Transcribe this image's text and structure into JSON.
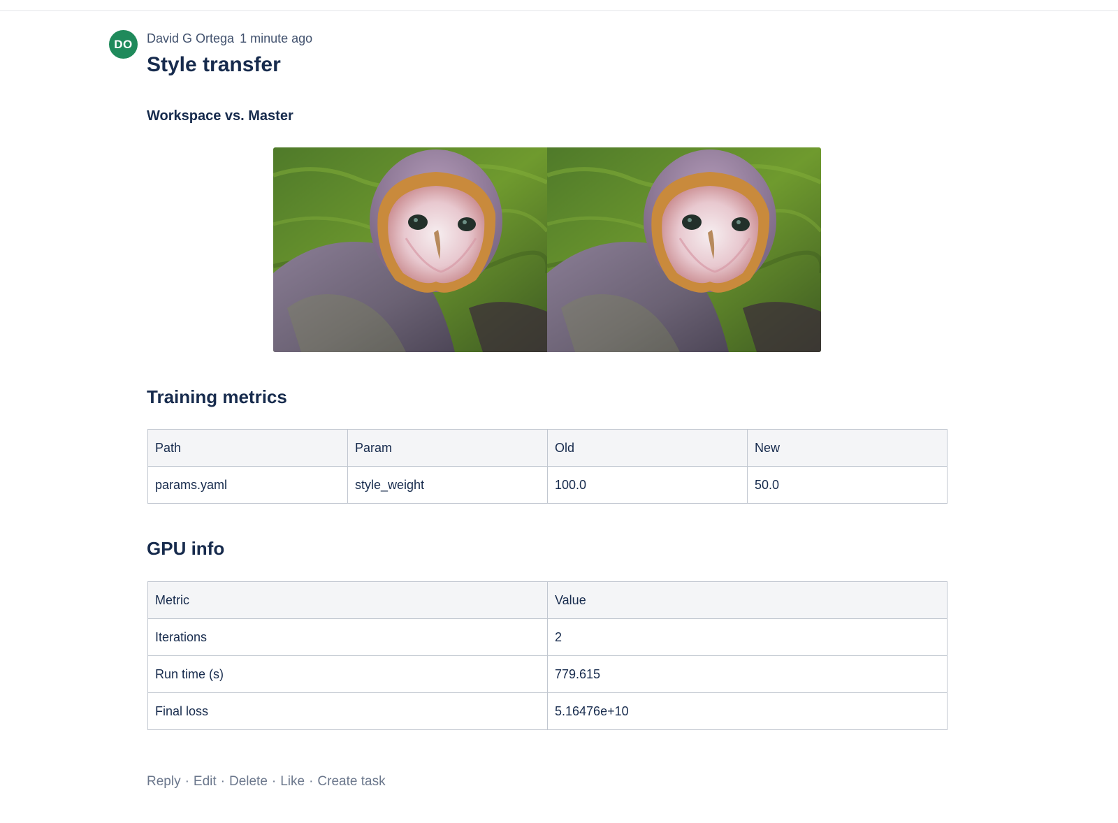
{
  "comment": {
    "author_initials": "DO",
    "author": "David G Ortega",
    "timestamp": "1 minute ago",
    "title": "Style transfer",
    "subheading": "Workspace vs. Master",
    "image_left_label": "Workspace owl image",
    "image_right_label": "Master owl image"
  },
  "training": {
    "heading": "Training metrics",
    "columns": [
      "Path",
      "Param",
      "Old",
      "New"
    ],
    "rows": [
      [
        "params.yaml",
        "style_weight",
        "100.0",
        "50.0"
      ]
    ]
  },
  "gpu": {
    "heading": "GPU info",
    "columns": [
      "Metric",
      "Value"
    ],
    "rows": [
      [
        "Iterations",
        "2"
      ],
      [
        "Run time (s)",
        "779.615"
      ],
      [
        "Final loss",
        "5.16476e+10"
      ]
    ]
  },
  "actions": {
    "reply": "Reply",
    "edit": "Edit",
    "delete": "Delete",
    "like": "Like",
    "create_task": "Create task",
    "separator": "·"
  },
  "colors": {
    "avatar_bg": "#1f8a5b",
    "text_primary": "#172b4d",
    "text_muted": "#6b778c",
    "header_bg": "#f4f5f7",
    "border": "#c1c7d0"
  }
}
